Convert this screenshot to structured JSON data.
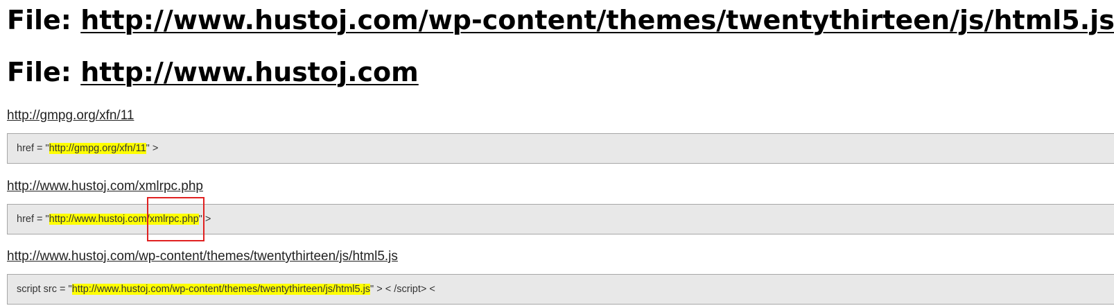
{
  "headings": [
    {
      "prefix": "File: ",
      "url": "http://www.hustoj.com/wp-content/themes/twentythirteen/js/html5.js"
    },
    {
      "prefix": "File: ",
      "url": "http://www.hustoj.com"
    }
  ],
  "results": [
    {
      "link": "http://gmpg.org/xfn/11",
      "code_prefix": "href = \"",
      "code_url": "http://gmpg.org/xfn/11",
      "code_suffix": "\" >"
    },
    {
      "link": "http://www.hustoj.com/xmlrpc.php",
      "code_prefix": "href = \"",
      "code_url_base": "http://www.hustoj.com/",
      "code_url_file": "xmlrpc.php",
      "code_suffix": "\" >"
    },
    {
      "link": "http://www.hustoj.com/wp-content/themes/twentythirteen/js/html5.js",
      "code_prefix": "script src = \"",
      "code_url": "http://www.hustoj.com/wp-content/themes/twentythirteen/js/html5.js",
      "code_suffix": "\" > < /script> <"
    }
  ],
  "colors": {
    "highlight": "#ffff00",
    "frame": "#e02020",
    "box_background": "#e8e8e8"
  }
}
